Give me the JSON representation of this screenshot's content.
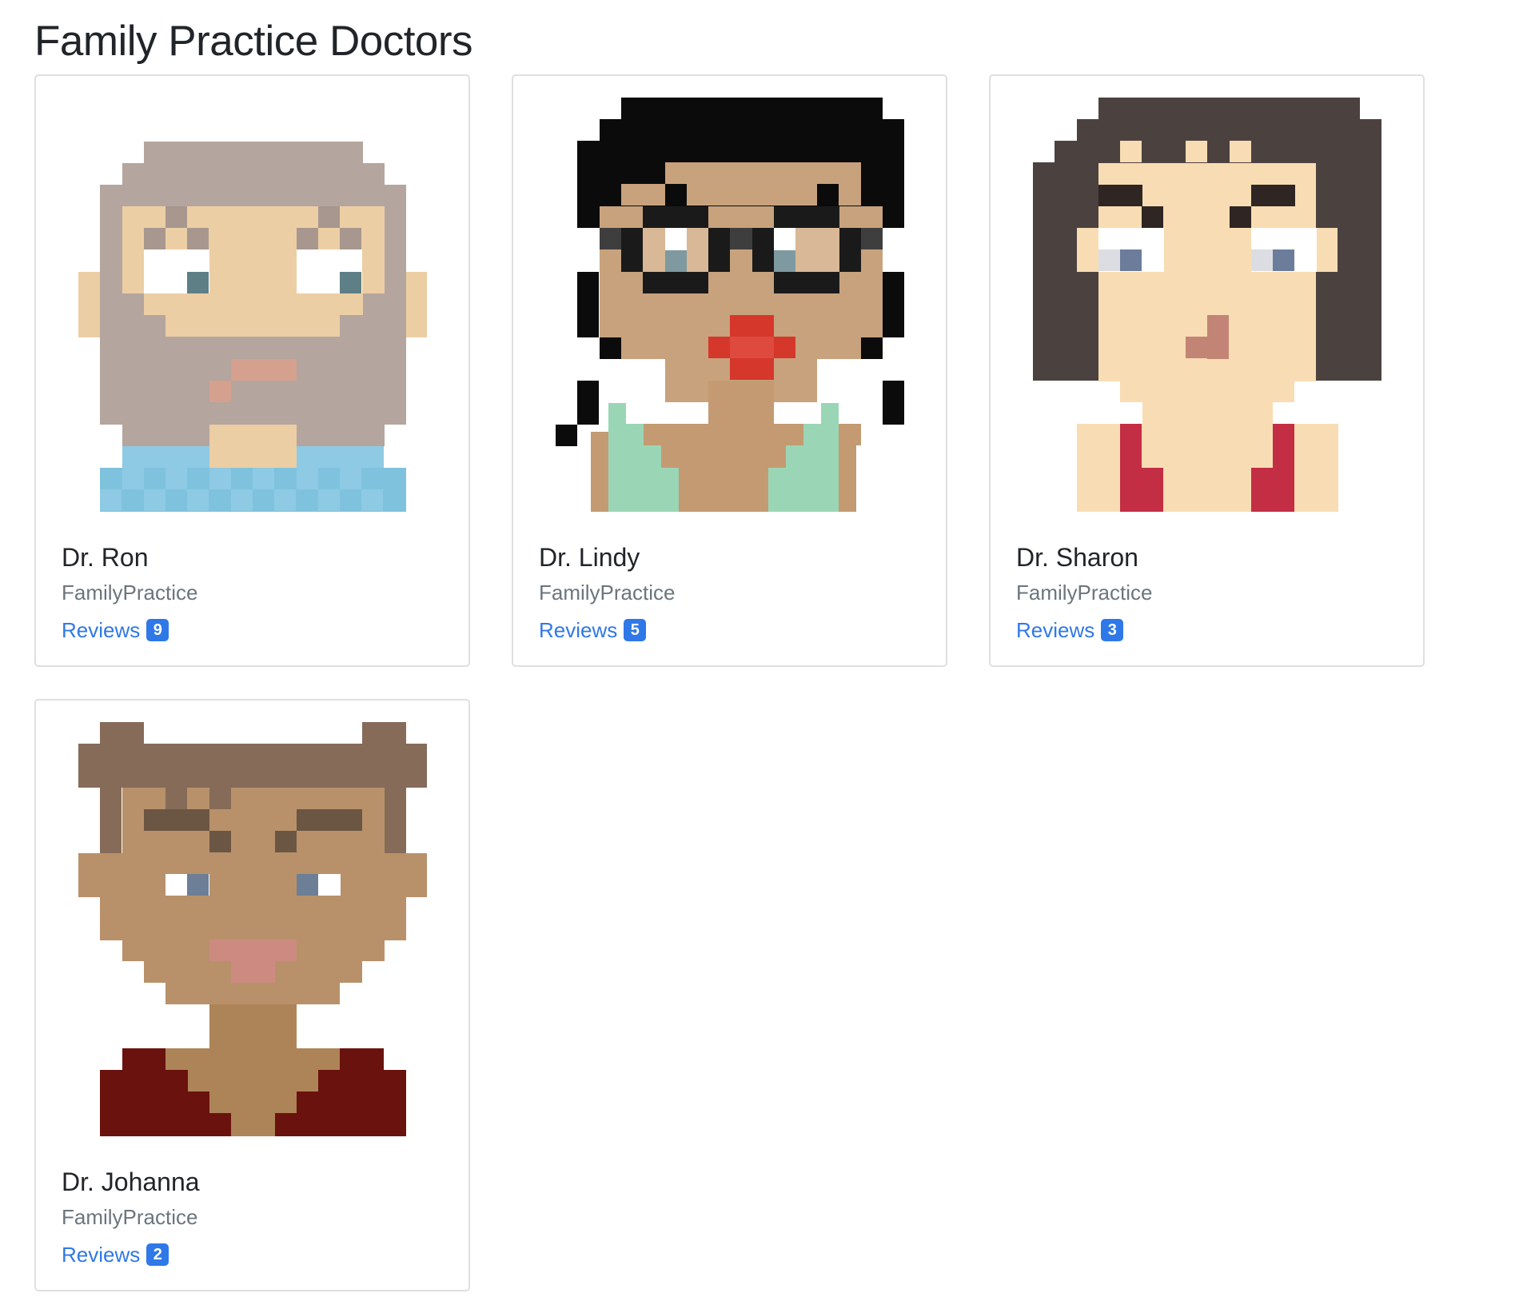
{
  "page": {
    "title": "Family Practice Doctors"
  },
  "doctors": [
    {
      "name": "Dr. Ron",
      "specialty": "FamilyPractice",
      "reviews_label": "Reviews",
      "review_count": "9",
      "avatar_icon": "bearded-man-avatar-icon",
      "avatar_colors": {
        "hair": "#b4a59e",
        "skin": "#eccea4",
        "brow": "#a7978f",
        "eye": "#5e7f85",
        "mouth": "#d6a08e",
        "shirt": "#7fc2de",
        "shirt_alt": "#8ecae4"
      }
    },
    {
      "name": "Dr. Lindy",
      "specialty": "FamilyPractice",
      "reviews_label": "Reviews",
      "review_count": "5",
      "avatar_icon": "woman-with-glasses-avatar-icon",
      "avatar_colors": {
        "hair": "#0b0b0b",
        "skin": "#c8a27d",
        "glasses": "#1a1a1a",
        "lips": "#d6372b",
        "collar": "#ffffff",
        "shirt": "#9ad6b5"
      }
    },
    {
      "name": "Dr. Sharon",
      "specialty": "FamilyPractice",
      "reviews_label": "Reviews",
      "review_count": "3",
      "avatar_icon": "long-haired-woman-avatar-icon",
      "avatar_colors": {
        "hair": "#4b4240",
        "skin": "#f8dcb3",
        "brow": "#2f2623",
        "eye": "#6b7d9b",
        "nose": "#c28575",
        "shirt": "#c42e45"
      }
    },
    {
      "name": "Dr. Johanna",
      "specialty": "FamilyPractice",
      "reviews_label": "Reviews",
      "review_count": "2",
      "avatar_icon": "short-haired-avatar-icon",
      "avatar_colors": {
        "hair": "#866b59",
        "skin": "#b8916a",
        "brow": "#6b5644",
        "eye": "#6c7f96",
        "mouth": "#cc8a80",
        "neck": "#ad8458",
        "shirt": "#6a120e"
      }
    }
  ]
}
